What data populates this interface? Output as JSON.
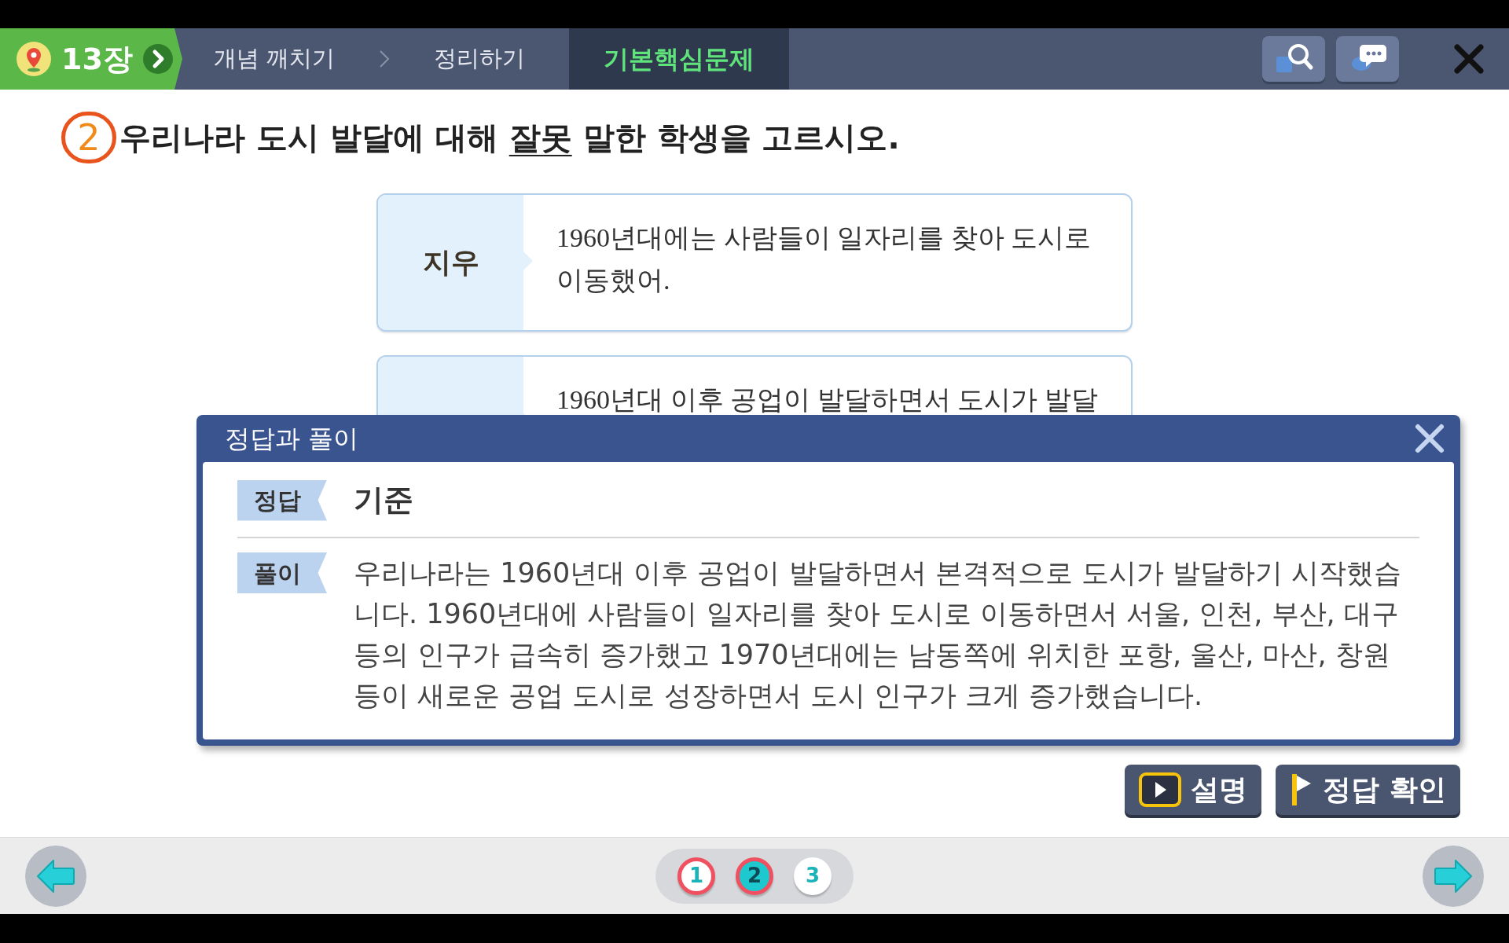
{
  "header": {
    "chapter": "13장",
    "crumbs": [
      {
        "label": "개념 깨치기",
        "selected": false
      },
      {
        "label": "정리하기",
        "selected": false
      },
      {
        "label": "기본핵심문제",
        "selected": true
      }
    ]
  },
  "question": {
    "number": "2",
    "parts": [
      {
        "text": "우리나라 도시 발달에 대해 ",
        "underlined": false
      },
      {
        "text": "잘못",
        "underlined": true
      },
      {
        "text": " 말한 학생을 고르시오.",
        "underlined": false
      }
    ]
  },
  "cards": [
    {
      "name": "지우",
      "text": "1960년대에는 사람들이 일자리를 찾아 도시로 이동했어."
    },
    {
      "text": "1960년대 이후 공업이 발달하면서 도시가 발달"
    }
  ],
  "popup": {
    "title": "정답과 풀이",
    "rows": [
      {
        "tag": "정답",
        "text": "기준",
        "kind": "answer"
      },
      {
        "tag": "풀이",
        "text": "우리나라는 1960년대 이후 공업이 발달하면서 본격적으로 도시가 발달하기 시작했습니다. 1960년대에 사람들이 일자리를 찾아 도시로 이동하면서 서울, 인천, 부산, 대구 등의 인구가 급속히 증가했고 1970년대에는 남동쪽에 위치한 포항, 울산, 마산, 창원 등이 새로운 공업 도시로 성장하면서 도시 인구가 크게 증가했습니다.",
        "kind": "explanation"
      }
    ]
  },
  "buttons": [
    {
      "label": "설명",
      "kind": "play"
    },
    {
      "label": "정답 확인",
      "kind": "flag"
    }
  ],
  "pages": [
    {
      "label": "1",
      "selected": false,
      "visited": true
    },
    {
      "label": "2",
      "selected": true,
      "visited": true
    },
    {
      "label": "3",
      "selected": false,
      "visited": false
    }
  ]
}
